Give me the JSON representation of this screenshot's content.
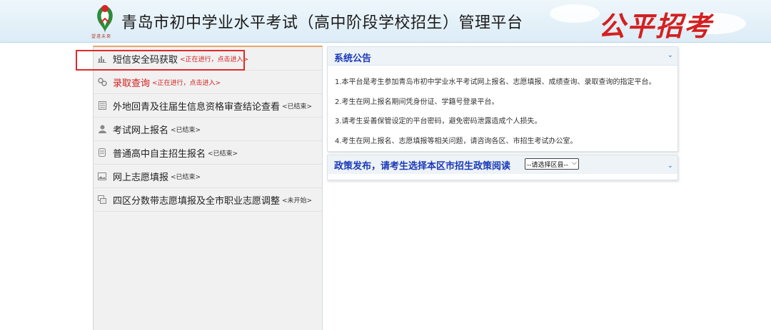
{
  "header": {
    "title": "青岛市初中学业水平考试（高中阶段学校招生）管理平台",
    "logo_caption": "望遠未來",
    "slogan": "公平招考",
    "logo_icon": "qingdao-education-logo-icon"
  },
  "sidebar": {
    "items": [
      {
        "label": "短信安全码获取",
        "status": "<正在进行，点击进入>",
        "icon": "chart-icon",
        "status_color": "#d41c1c",
        "label_color": "#222222"
      },
      {
        "label": "录取查询",
        "status": "<正在进行，点击进入>",
        "icon": "gears-icon",
        "status_color": "#d41c1c",
        "label_color": "#d41c1c"
      },
      {
        "label": "外地回青及往届生信息资格审查结论查看",
        "status": "<已结束>",
        "icon": "document-icon",
        "status_color": "#333333",
        "label_color": "#222222"
      },
      {
        "label": "考试网上报名",
        "status": "<已结束>",
        "icon": "user-icon",
        "status_color": "#333333",
        "label_color": "#222222"
      },
      {
        "label": "普通高中自主招生报名",
        "status": "<已结束>",
        "icon": "form-icon",
        "status_color": "#333333",
        "label_color": "#222222"
      },
      {
        "label": "网上志愿填报",
        "status": "<已结束>",
        "icon": "picture-icon",
        "status_color": "#333333",
        "label_color": "#222222"
      },
      {
        "label": "四区分数带志愿填报及全市职业志愿调整",
        "status": "<未开始>",
        "icon": "stack-icon",
        "status_color": "#333333",
        "label_color": "#222222"
      }
    ]
  },
  "announcement": {
    "title": "系统公告",
    "lines": [
      "1.本平台是考生参加青岛市初中学业水平考试网上报名、志愿填报、成绩查询、录取查询的指定平台。",
      "2.考生在网上报名期间凭身份证、学籍号登录平台。",
      "3.请考生妥善保管设定的平台密码，避免密码泄露造成个人损失。",
      "4.考生在网上报名、志愿填报等相关问题，请咨询各区、市招生考试办公室。"
    ]
  },
  "policy": {
    "title": "政策发布，请考生选择本区市招生政策阅读",
    "select_value": "--请选择区县--"
  },
  "colors": {
    "accent_blue": "#1a39b8",
    "active_red": "#d41c1c",
    "highlight_border": "#e02a2a"
  }
}
